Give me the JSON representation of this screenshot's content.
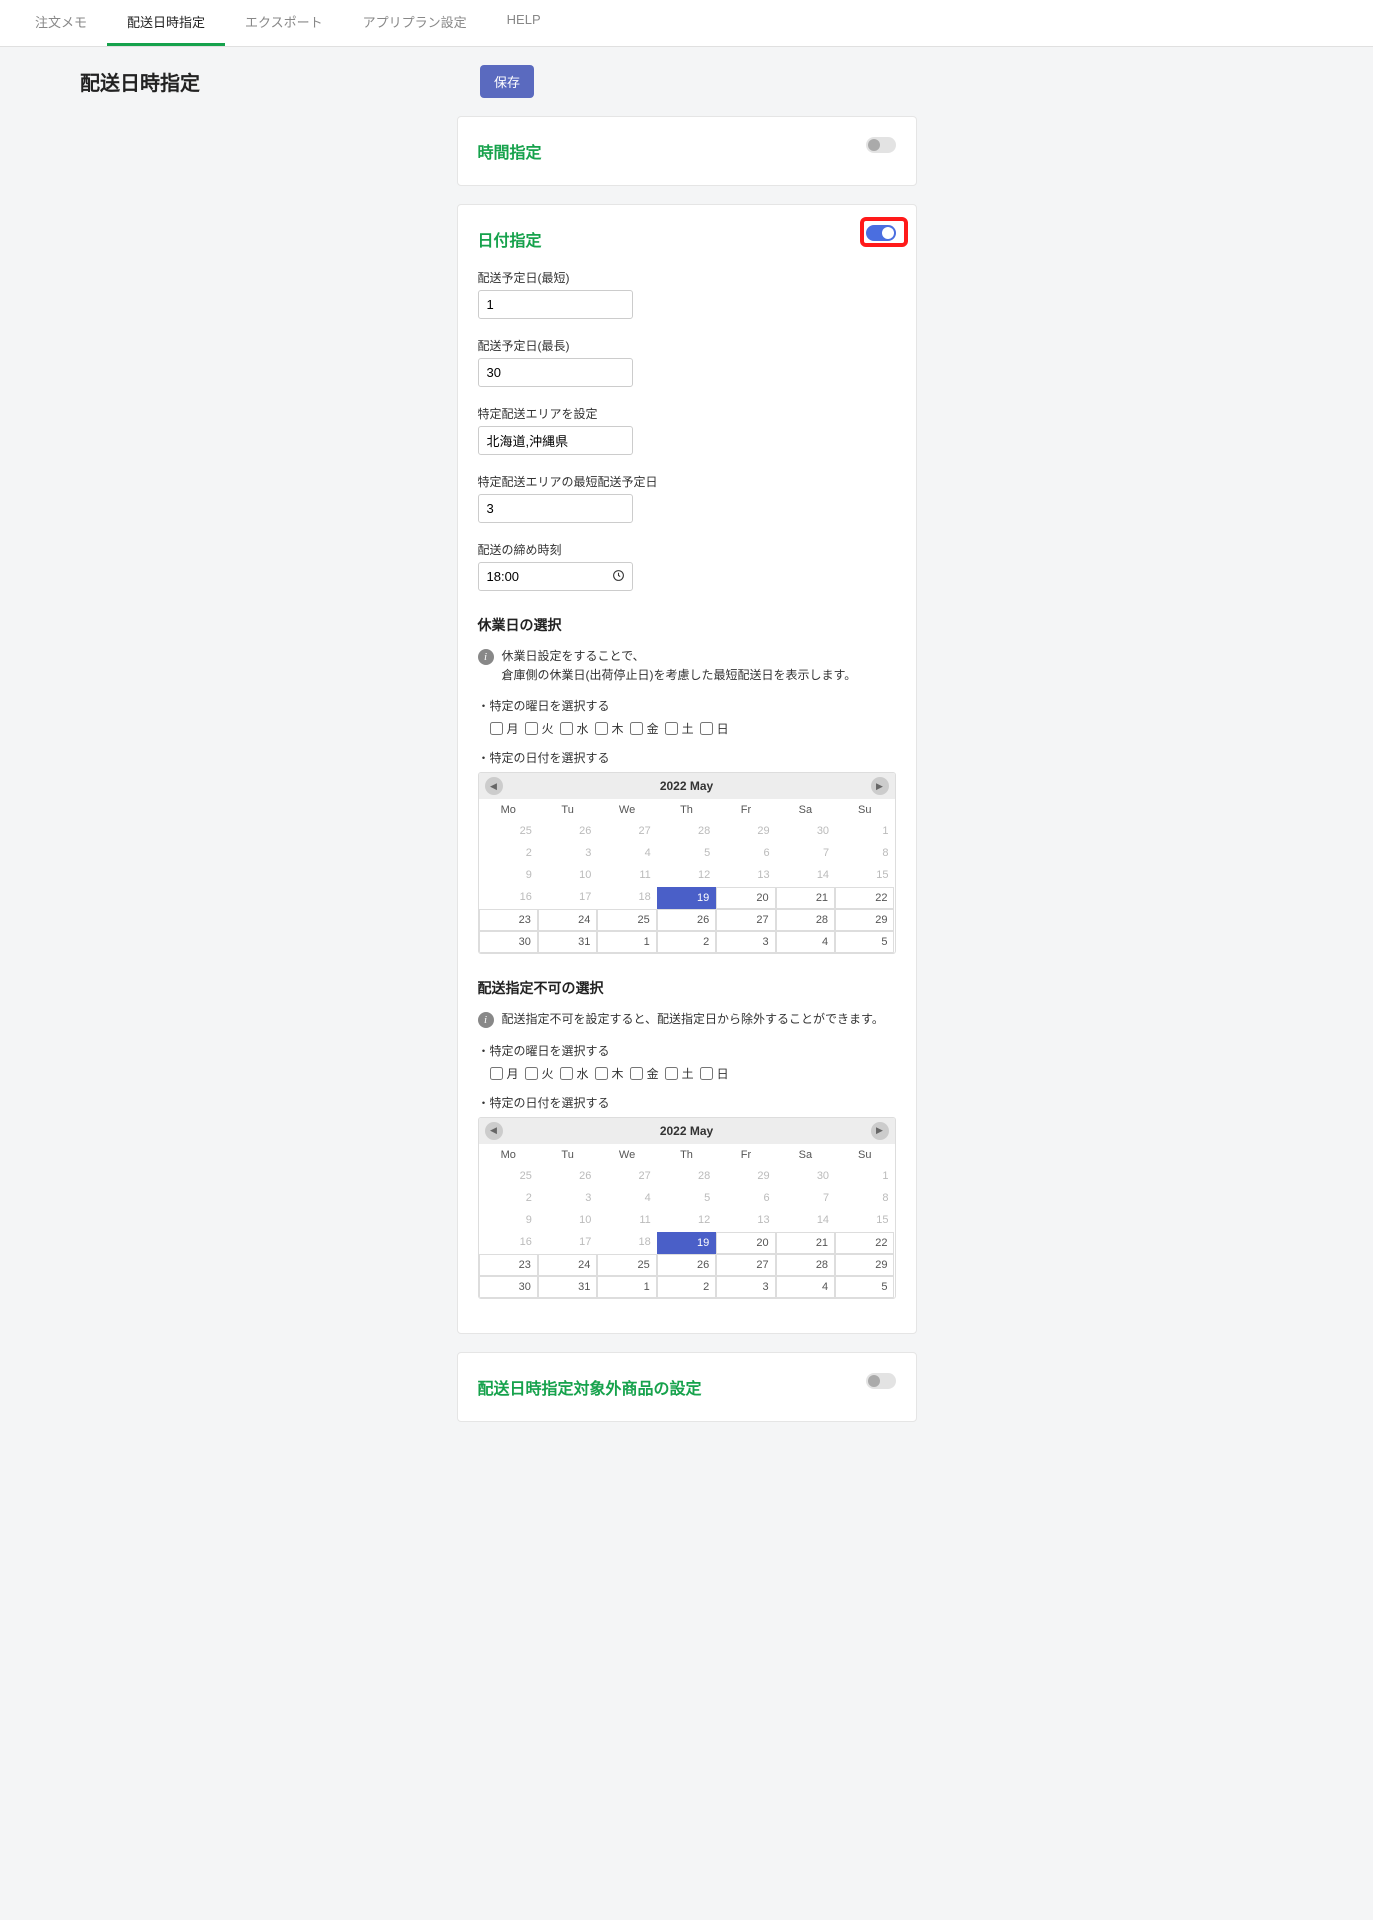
{
  "nav": {
    "tabs": [
      {
        "label": "注文メモ",
        "active": false
      },
      {
        "label": "配送日時指定",
        "active": true
      },
      {
        "label": "エクスポート",
        "active": false
      },
      {
        "label": "アプリプラン設定",
        "active": false
      },
      {
        "label": "HELP",
        "active": false
      }
    ]
  },
  "header": {
    "title": "配送日時指定",
    "save_label": "保存"
  },
  "time_section": {
    "title": "時間指定",
    "toggle_on": false
  },
  "date_section": {
    "title": "日付指定",
    "toggle_on": true,
    "highlighted": true,
    "fields": {
      "shortest_label": "配送予定日(最短)",
      "shortest_value": "1",
      "longest_label": "配送予定日(最長)",
      "longest_value": "30",
      "area_label": "特定配送エリアを設定",
      "area_value": "北海道,沖縄県",
      "area_shortest_label": "特定配送エリアの最短配送予定日",
      "area_shortest_value": "3",
      "cutoff_label": "配送の締め時刻",
      "cutoff_value": "18:00"
    },
    "holiday": {
      "title": "休業日の選択",
      "info": "休業日設定をすることで、\n倉庫側の休業日(出荷停止日)を考慮した最短配送日を表示します。",
      "weekday_label": "・特定の曜日を選択する",
      "date_label": "・特定の日付を選択する"
    },
    "unavailable": {
      "title": "配送指定不可の選択",
      "info": "配送指定不可を設定すると、配送指定日から除外することができます。",
      "weekday_label": "・特定の曜日を選択する",
      "date_label": "・特定の日付を選択する"
    }
  },
  "weekdays": [
    "月",
    "火",
    "水",
    "木",
    "金",
    "土",
    "日"
  ],
  "calendar": {
    "title": "2022 May",
    "dow": [
      "Mo",
      "Tu",
      "We",
      "Th",
      "Fr",
      "Sa",
      "Su"
    ],
    "cells": [
      {
        "n": "25",
        "s": "prev"
      },
      {
        "n": "26",
        "s": "prev"
      },
      {
        "n": "27",
        "s": "prev"
      },
      {
        "n": "28",
        "s": "prev"
      },
      {
        "n": "29",
        "s": "prev"
      },
      {
        "n": "30",
        "s": "prev"
      },
      {
        "n": "1",
        "s": "past"
      },
      {
        "n": "2",
        "s": "past"
      },
      {
        "n": "3",
        "s": "past"
      },
      {
        "n": "4",
        "s": "past"
      },
      {
        "n": "5",
        "s": "past"
      },
      {
        "n": "6",
        "s": "past"
      },
      {
        "n": "7",
        "s": "past"
      },
      {
        "n": "8",
        "s": "past"
      },
      {
        "n": "9",
        "s": "past"
      },
      {
        "n": "10",
        "s": "past"
      },
      {
        "n": "11",
        "s": "past"
      },
      {
        "n": "12",
        "s": "past"
      },
      {
        "n": "13",
        "s": "past"
      },
      {
        "n": "14",
        "s": "past"
      },
      {
        "n": "15",
        "s": "past"
      },
      {
        "n": "16",
        "s": "past"
      },
      {
        "n": "17",
        "s": "past"
      },
      {
        "n": "18",
        "s": "past"
      },
      {
        "n": "19",
        "s": "today"
      },
      {
        "n": "20",
        "s": "in"
      },
      {
        "n": "21",
        "s": "in"
      },
      {
        "n": "22",
        "s": "in"
      },
      {
        "n": "23",
        "s": "in"
      },
      {
        "n": "24",
        "s": "in"
      },
      {
        "n": "25",
        "s": "in"
      },
      {
        "n": "26",
        "s": "in"
      },
      {
        "n": "27",
        "s": "in"
      },
      {
        "n": "28",
        "s": "in"
      },
      {
        "n": "29",
        "s": "in"
      },
      {
        "n": "30",
        "s": "in"
      },
      {
        "n": "31",
        "s": "in"
      },
      {
        "n": "1",
        "s": "in"
      },
      {
        "n": "2",
        "s": "in"
      },
      {
        "n": "3",
        "s": "in"
      },
      {
        "n": "4",
        "s": "in"
      },
      {
        "n": "5",
        "s": "in"
      }
    ]
  },
  "excluded_section": {
    "title": "配送日時指定対象外商品の設定",
    "toggle_on": false
  }
}
